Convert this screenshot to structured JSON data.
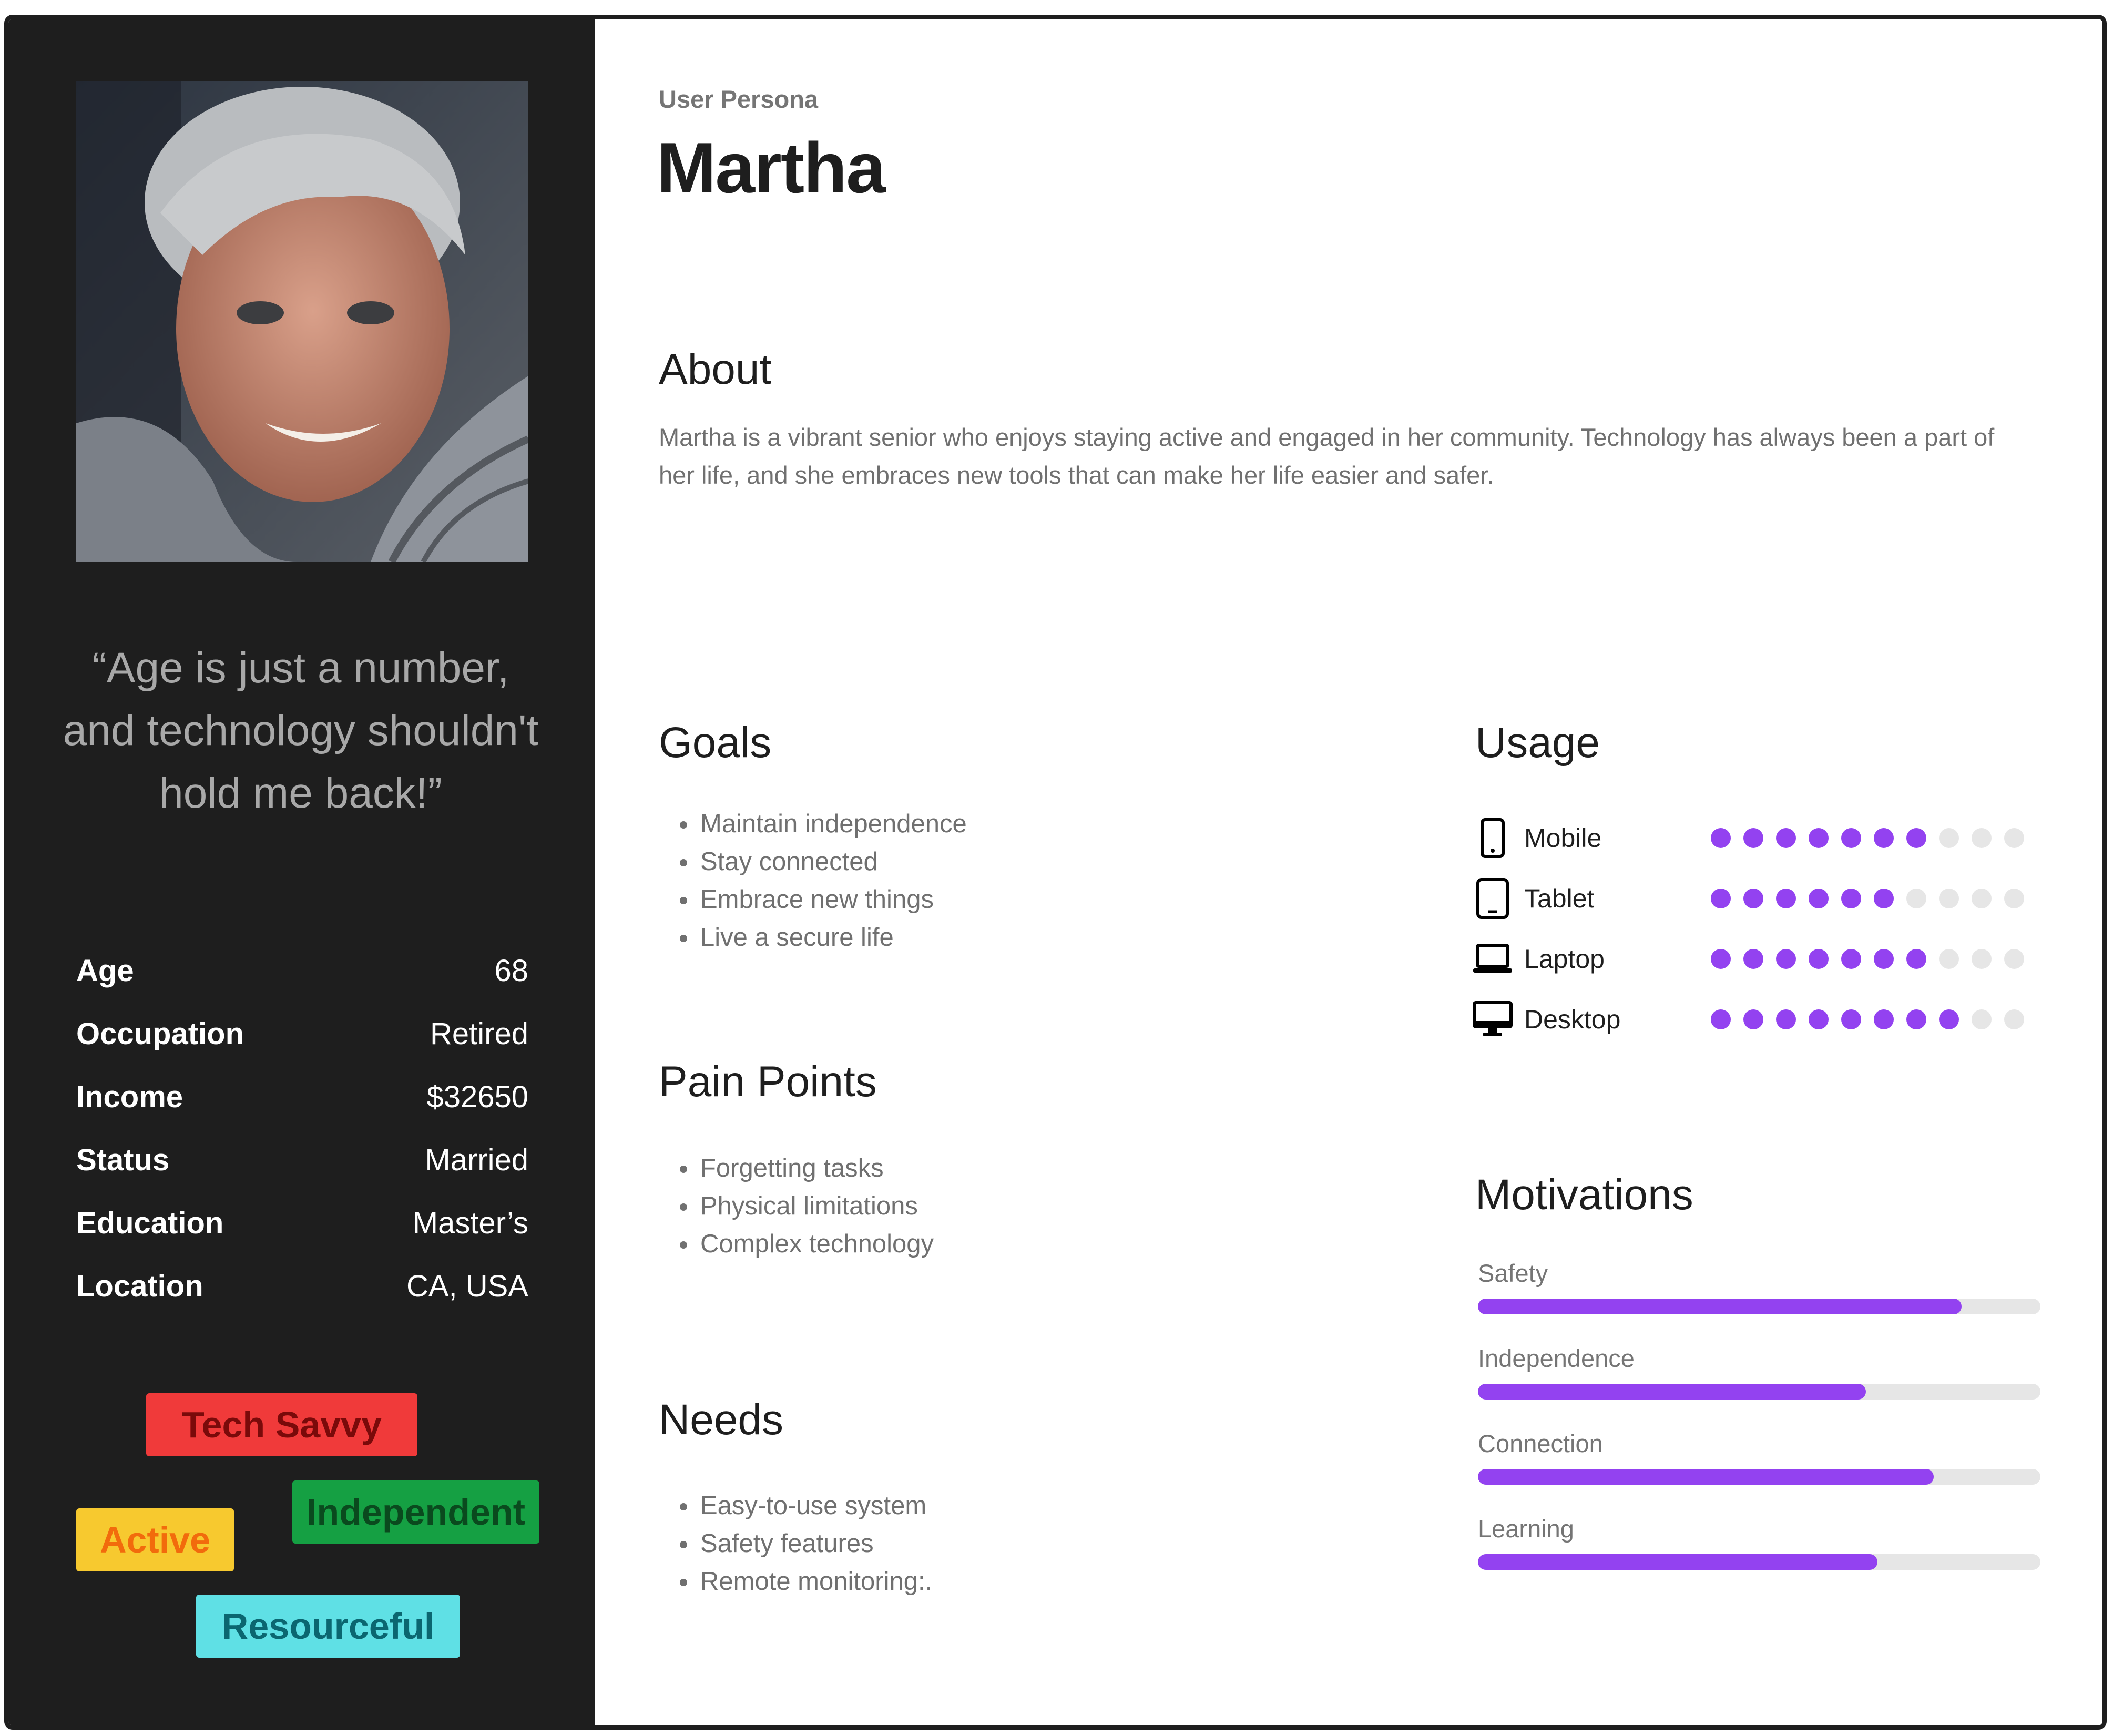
{
  "persona": {
    "eyebrow": "User Persona",
    "name": "Martha",
    "quote": "“Age is just a number, and technology shouldn't hold me back!”"
  },
  "facts": [
    {
      "label": "Age",
      "value": "68"
    },
    {
      "label": "Occupation",
      "value": "Retired"
    },
    {
      "label": "Income",
      "value": "$32650"
    },
    {
      "label": "Status",
      "value": "Married"
    },
    {
      "label": "Education",
      "value": "Master’s"
    },
    {
      "label": "Location",
      "value": "CA, USA"
    }
  ],
  "tags": [
    {
      "label": "Tech Savvy",
      "color": "#f03a3a"
    },
    {
      "label": "Independent",
      "color": "#15a043"
    },
    {
      "label": "Active",
      "color": "#f7c92f"
    },
    {
      "label": "Resourceful",
      "color": "#5fe0e5"
    }
  ],
  "about": {
    "title": "About",
    "text": "Martha is a vibrant senior who enjoys staying active and engaged in her community. Technology has always been a part of her life, and she embraces new tools that can make her life easier and safer."
  },
  "goals": {
    "title": "Goals",
    "items": [
      "Maintain independence",
      "Stay connected",
      "Embrace new things",
      "Live a secure life"
    ]
  },
  "pain_points": {
    "title": "Pain Points",
    "items": [
      "Forgetting tasks",
      "Physical limitations",
      "Complex technology"
    ]
  },
  "needs": {
    "title": "Needs",
    "items": [
      "Easy-to-use system",
      "Safety features",
      "Remote monitoring:."
    ]
  },
  "usage": {
    "title": "Usage",
    "max": 10,
    "accent": "#9342f0",
    "devices": [
      {
        "label": "Mobile",
        "icon": "mobile-icon",
        "level": 7
      },
      {
        "label": "Tablet",
        "icon": "tablet-icon",
        "level": 6
      },
      {
        "label": "Laptop",
        "icon": "laptop-icon",
        "level": 7
      },
      {
        "label": "Desktop",
        "icon": "desktop-icon",
        "level": 8
      }
    ]
  },
  "motivations": {
    "title": "Motivations",
    "items": [
      {
        "label": "Safety",
        "percent": 86
      },
      {
        "label": "Independence",
        "percent": 69
      },
      {
        "label": "Connection",
        "percent": 81
      },
      {
        "label": "Learning",
        "percent": 71
      }
    ]
  }
}
